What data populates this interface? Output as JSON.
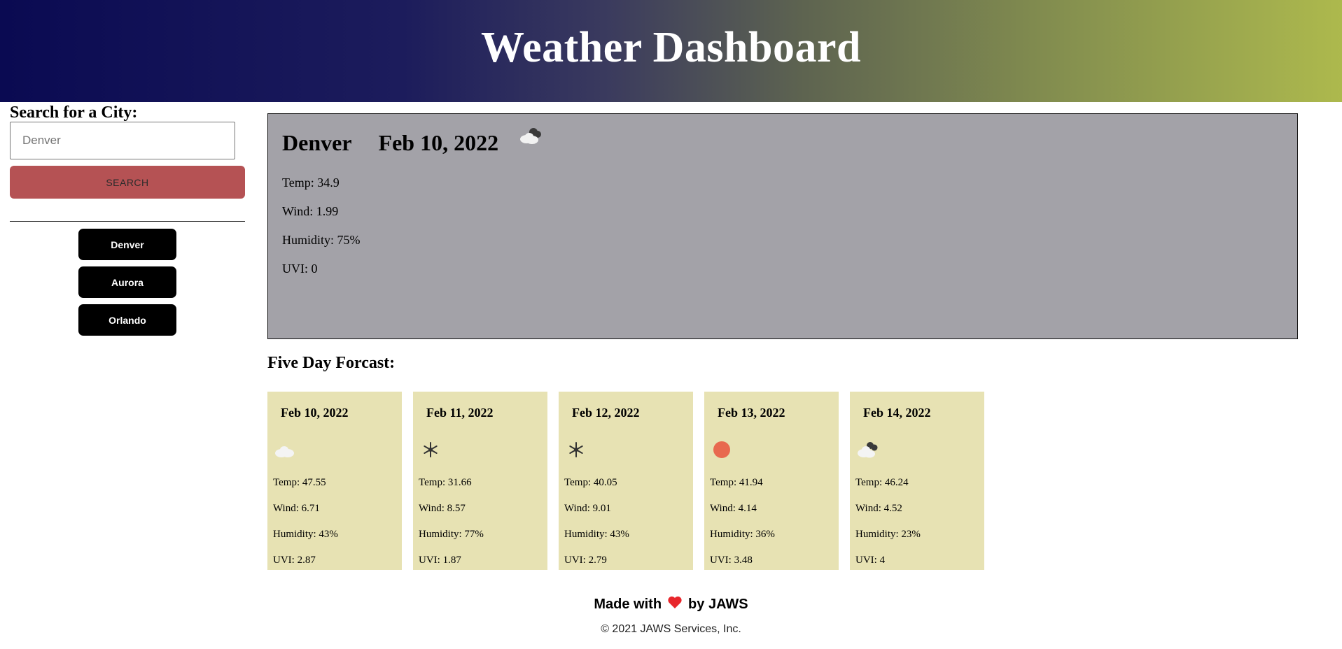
{
  "header": {
    "title": "Weather Dashboard"
  },
  "sidebar": {
    "search_title": "Search for a City:",
    "search_placeholder": "Denver",
    "search_button": "SEARCH",
    "history": [
      "Denver",
      "Aurora",
      "Orlando"
    ]
  },
  "current": {
    "city": "Denver",
    "date": "Feb 10, 2022",
    "icon": "partly-cloudy-icon",
    "labels": {
      "temp": "Temp: ",
      "wind": "Wind: ",
      "humidity": "Humidity: ",
      "uvi": "UVI: "
    },
    "temp": "34.9",
    "wind": "1.99",
    "humidity": "75%",
    "uvi": "0"
  },
  "forecast": {
    "title": "Five Day Forcast:",
    "days": [
      {
        "date": "Feb 10, 2022",
        "icon": "cloud-icon",
        "temp": "47.55",
        "wind": "6.71",
        "humidity": "43%",
        "uvi": "2.87"
      },
      {
        "date": "Feb 11, 2022",
        "icon": "snow-icon",
        "temp": "31.66",
        "wind": "8.57",
        "humidity": "77%",
        "uvi": "1.87"
      },
      {
        "date": "Feb 12, 2022",
        "icon": "snow-icon",
        "temp": "40.05",
        "wind": "9.01",
        "humidity": "43%",
        "uvi": "2.79"
      },
      {
        "date": "Feb 13, 2022",
        "icon": "sun-icon",
        "temp": "41.94",
        "wind": "4.14",
        "humidity": "36%",
        "uvi": "3.48"
      },
      {
        "date": "Feb 14, 2022",
        "icon": "partly-cloudy-icon",
        "temp": "46.24",
        "wind": "4.52",
        "humidity": "23%",
        "uvi": "4"
      }
    ]
  },
  "footer": {
    "made_prefix": "Made with",
    "made_suffix": "by JAWS",
    "heart_icon": "heart-icon",
    "copyright": "© 2021 JAWS Services, Inc."
  },
  "colors": {
    "current_bg": "#a3a2a8",
    "card_bg": "#e7e2b3",
    "search_button": "#b55254",
    "heart": "#e8262b",
    "sun": "#e8694f"
  }
}
